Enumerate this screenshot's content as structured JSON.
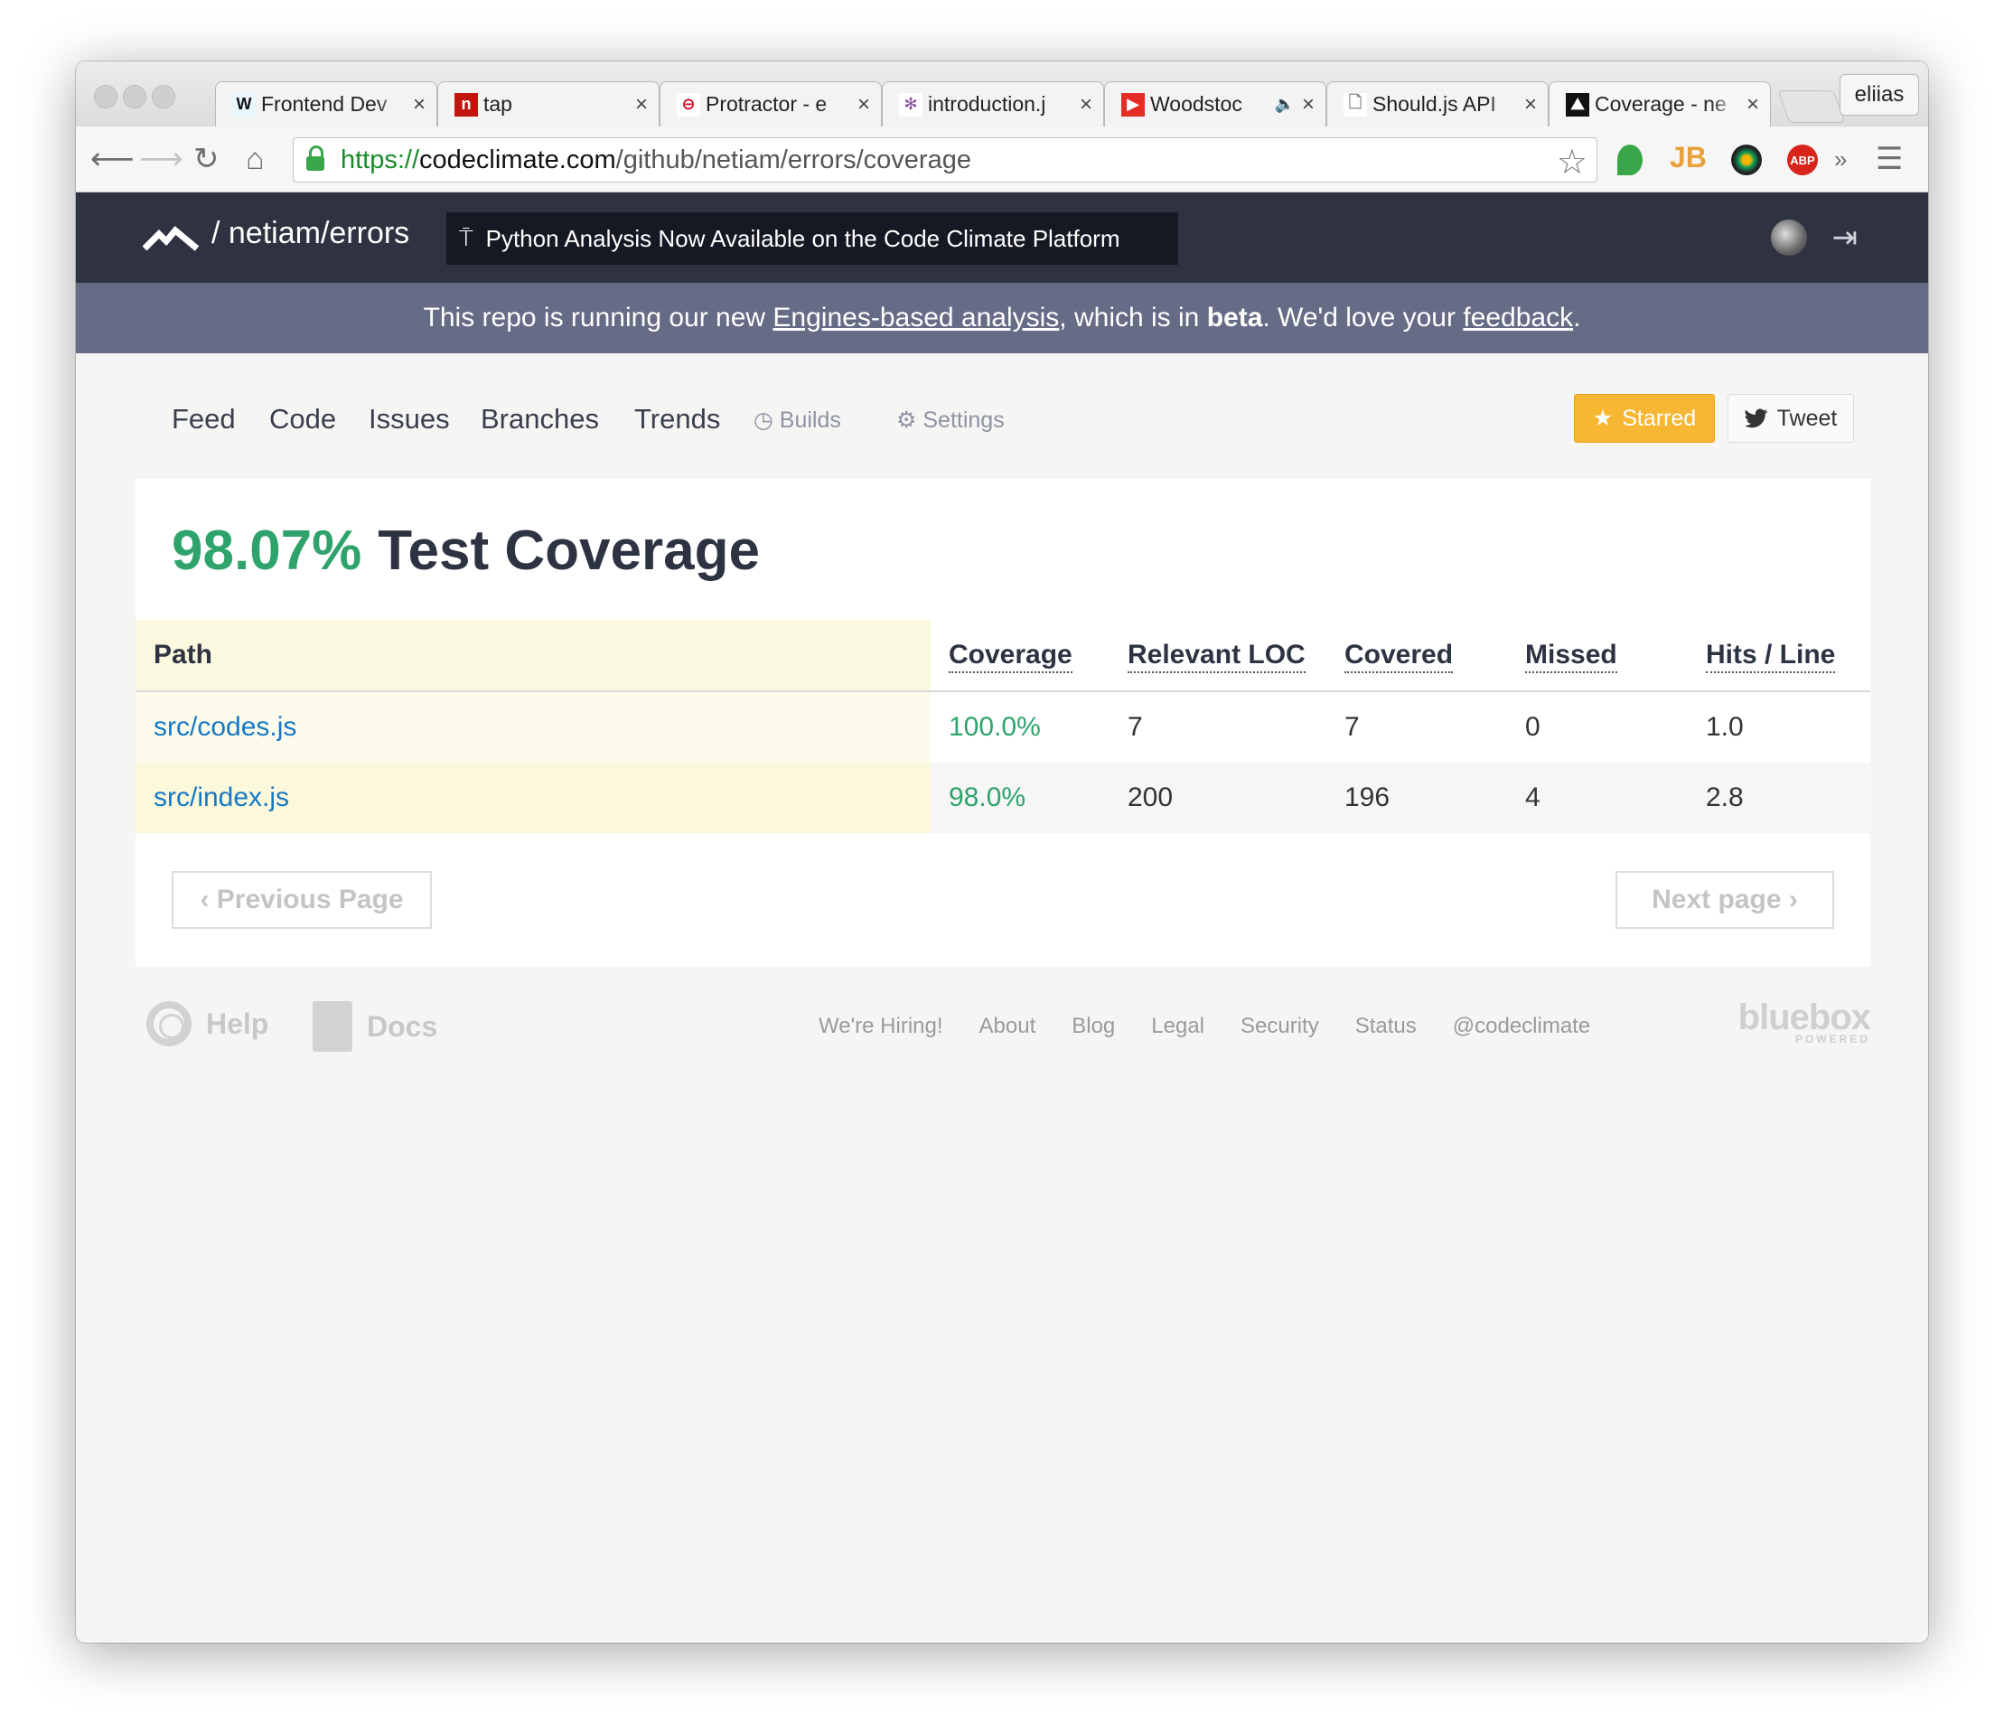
{
  "browser": {
    "tabs": [
      {
        "title": "Frontend Dev",
        "favicon": "W",
        "favicon_bg": "#e9f7ff",
        "favicon_color": "#111"
      },
      {
        "title": "tap",
        "favicon": "n",
        "favicon_bg": "#c0160d",
        "favicon_color": "#fff"
      },
      {
        "title": "Protractor - e",
        "favicon": "⊖",
        "favicon_bg": "#ffffff",
        "favicon_color": "#d0021b"
      },
      {
        "title": "introduction.j",
        "favicon": "✻",
        "favicon_bg": "#ffffff",
        "favicon_color": "#8a4c9c"
      },
      {
        "title": "Woodstoc",
        "favicon": "▶",
        "favicon_bg": "#e52d27",
        "favicon_color": "#fff"
      },
      {
        "title": "Should.js API",
        "favicon": "🗋",
        "favicon_bg": "#ffffff",
        "favicon_color": "#888"
      },
      {
        "title": "Coverage - ne",
        "favicon": "⛰",
        "favicon_bg": "#111",
        "favicon_color": "#fff"
      }
    ],
    "close_glyph": "×",
    "audio_glyph": "🔈",
    "profile_name": "eliias",
    "url": {
      "scheme": "https://",
      "host": "codeclimate.com",
      "path": "/github/netiam/errors/coverage"
    },
    "extensions": {
      "abp_label": "ABP",
      "jb_label": "JB",
      "overflow": "»"
    }
  },
  "app": {
    "repo_name": "/ netiam/errors",
    "announcement": "Python Analysis Now Available on the Code Climate Platform",
    "banner": {
      "prefix": "This repo is running our new ",
      "link1": "Engines-based analysis",
      "middle": ", which is in ",
      "bold": "beta",
      "after": ". We'd love your ",
      "link2": "feedback",
      "end": "."
    },
    "nav": {
      "items": [
        "Feed",
        "Code",
        "Issues",
        "Branches",
        "Trends"
      ],
      "builds": "Builds",
      "settings": "Settings",
      "starred": "Starred",
      "tweet": "Tweet"
    },
    "coverage": {
      "percent": "98.07%",
      "title": "Test Coverage",
      "columns": [
        "Path",
        "Coverage",
        "Relevant LOC",
        "Covered",
        "Missed",
        "Hits / Line"
      ],
      "rows": [
        {
          "path": "src/codes.js",
          "coverage": "100.0%",
          "relevant": "7",
          "covered": "7",
          "missed": "0",
          "hits": "1.0"
        },
        {
          "path": "src/index.js",
          "coverage": "98.0%",
          "relevant": "200",
          "covered": "196",
          "missed": "4",
          "hits": "2.8"
        }
      ],
      "prev_page": "Previous Page",
      "next_page": "Next page"
    },
    "footer": {
      "help": "Help",
      "docs": "Docs",
      "links": [
        "We're Hiring!",
        "About",
        "Blog",
        "Legal",
        "Security",
        "Status",
        "@codeclimate"
      ],
      "sponsor": "bluebox",
      "sponsor_sub": "POWERED"
    },
    "colors": {
      "accent_green": "#2ea36b",
      "header_bg": "#2f3341",
      "banner_bg": "#666b86",
      "star_button": "#f7b733"
    }
  }
}
